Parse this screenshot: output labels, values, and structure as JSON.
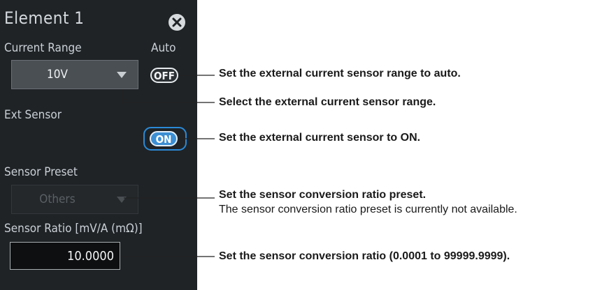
{
  "panel": {
    "title": "Element 1",
    "current_range_label": "Current Range",
    "auto_label": "Auto",
    "current_range_value": "10V",
    "auto_toggle": "OFF",
    "ext_sensor_label": "Ext Sensor",
    "ext_sensor_toggle": "ON",
    "sensor_preset_label": "Sensor Preset",
    "sensor_preset_value": "Others",
    "sensor_ratio_label": "Sensor Ratio [mV/A (mΩ)]",
    "sensor_ratio_value": "10.0000"
  },
  "annotations": {
    "auto": "Set the external current sensor range to auto.",
    "range": "Select the external current sensor range.",
    "ext_sensor": "Set the external current sensor to ON.",
    "preset": "Set the sensor conversion ratio preset.",
    "preset_note": "The sensor conversion ratio preset is currently not available.",
    "ratio": "Set the sensor conversion ratio (0.0001 to 99999.9999)."
  },
  "colors": {
    "panel_bg": "#1f2326",
    "accent_blue": "#3c8fd3",
    "highlight_border": "#2a8ad8"
  }
}
